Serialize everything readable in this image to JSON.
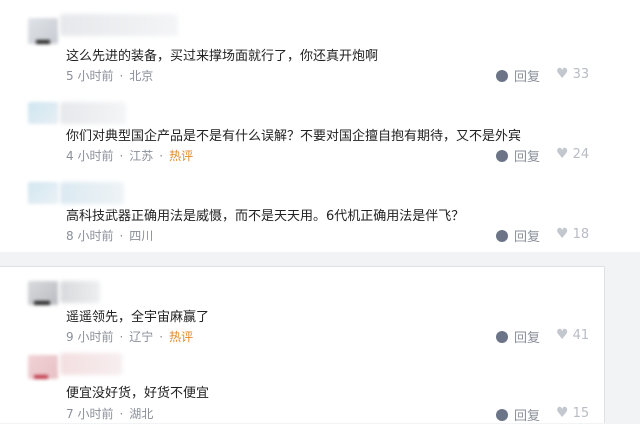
{
  "comments": [
    {
      "text": "这么先进的装备，买过来撑场面就行了，你还真开炮啊",
      "time": "5 小时前",
      "location": "北京",
      "hot": "",
      "reply": "回复",
      "likes": "33"
    },
    {
      "text": "你们对典型国企产品是不是有什么误解？不要对国企擅自抱有期待，又不是外宾",
      "time": "4 小时前",
      "location": "江苏",
      "hot": "热评",
      "reply": "回复",
      "likes": "24"
    },
    {
      "text": "高科技武器正确用法是威慑，而不是天天用。6代机正确用法是伴飞？",
      "time": "8 小时前",
      "location": "四川",
      "hot": "",
      "reply": "回复",
      "likes": "18"
    },
    {
      "text": "遥遥领先，全宇宙麻赢了",
      "time": "9 小时前",
      "location": "辽宁",
      "hot": "热评",
      "reply": "回复",
      "likes": "41"
    },
    {
      "text": "便宜没好货，好货不便宜",
      "time": "7 小时前",
      "location": "湖北",
      "hot": "",
      "reply": "回复",
      "likes": "15"
    }
  ],
  "colors": {
    "hot": "#e0892a",
    "meta": "#8a8f99",
    "reply_icon": "#6c7587"
  },
  "icons": {
    "reply": "comment-bubble-icon",
    "like": "heart-icon"
  }
}
